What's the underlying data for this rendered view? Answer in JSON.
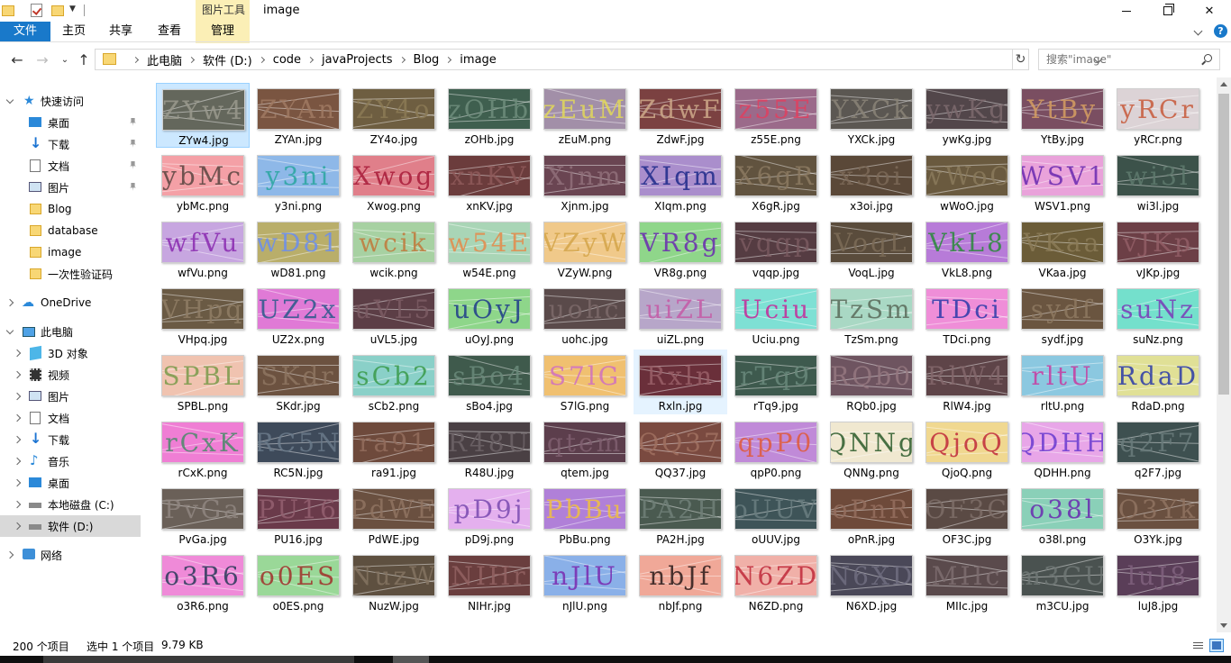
{
  "window": {
    "title": "image",
    "contextual_tab_group": "图片工具",
    "controls": {
      "minimize": "minimize",
      "maximize": "restore",
      "close": "✕"
    }
  },
  "ribbon": {
    "tabs": [
      "文件",
      "主页",
      "共享",
      "查看",
      "管理"
    ],
    "help": "?"
  },
  "address": {
    "breadcrumbs": [
      "此电脑",
      "软件 (D:)",
      "code",
      "javaProjects",
      "Blog",
      "image"
    ],
    "search_placeholder": "搜索\"image\""
  },
  "navigation": {
    "quick_access": "快速访问",
    "quick_items": [
      "桌面",
      "下载",
      "文档",
      "图片",
      "Blog",
      "database",
      "image",
      "一次性验证码"
    ],
    "onedrive": "OneDrive",
    "this_pc": "此电脑",
    "pc_items": [
      "3D 对象",
      "视频",
      "图片",
      "文档",
      "下载",
      "音乐",
      "桌面",
      "本地磁盘 (C:)",
      "软件 (D:)"
    ],
    "network": "网络"
  },
  "files": [
    {
      "name": "ZYw4.jpg",
      "text": "ZYw4",
      "bg": "#64675c",
      "fg": "#9b9a8e"
    },
    {
      "name": "ZYAn.jpg",
      "text": "ZYAn",
      "bg": "#7a5541",
      "fg": "#a07a63"
    },
    {
      "name": "ZY4o.jpg",
      "text": "ZY4o",
      "bg": "#6e5e41",
      "fg": "#8c7b56"
    },
    {
      "name": "zOHb.jpg",
      "text": "zOHb",
      "bg": "#3f5f4f",
      "fg": "#6e8d7c"
    },
    {
      "name": "zEuM.png",
      "text": "zEuM",
      "bg": "#a28fa8",
      "fg": "#e2d85a"
    },
    {
      "name": "ZdwF.jpg",
      "text": "ZdwF",
      "bg": "#7b4141",
      "fg": "#cfaa8a"
    },
    {
      "name": "z55E.png",
      "text": "z55E",
      "bg": "#9b6a8a",
      "fg": "#e04060"
    },
    {
      "name": "YXCk.jpg",
      "text": "YXCk",
      "bg": "#5b5752",
      "fg": "#8a8478"
    },
    {
      "name": "ywKg.jpg",
      "text": "ywKg",
      "bg": "#52464a",
      "fg": "#7d6a6e"
    },
    {
      "name": "YtBy.jpg",
      "text": "YtBy",
      "bg": "#7a4e61",
      "fg": "#d69f62"
    },
    {
      "name": "yRCr.png",
      "text": "yRCr",
      "bg": "#dcd3d6",
      "fg": "#c75a3a"
    },
    {
      "name": "ybMc.png",
      "text": "ybMc",
      "bg": "#f4a0a6",
      "fg": "#5a4540"
    },
    {
      "name": "y3ni.png",
      "text": "y3ni",
      "bg": "#8eb8e8",
      "fg": "#2aa6a0"
    },
    {
      "name": "Xwog.png",
      "text": "Xwog",
      "bg": "#e07f8a",
      "fg": "#a81c3a"
    },
    {
      "name": "xnKV.jpg",
      "text": "xnKV",
      "bg": "#6b3c3c",
      "fg": "#8f5a5a"
    },
    {
      "name": "Xjnm.jpg",
      "text": "Xjnm",
      "bg": "#6a4552",
      "fg": "#91707a"
    },
    {
      "name": "XIqm.png",
      "text": "XIqm",
      "bg": "#aa8ecc",
      "fg": "#1e2a8a"
    },
    {
      "name": "X6gR.jpg",
      "text": "X6gR",
      "bg": "#61533f",
      "fg": "#8c7a62"
    },
    {
      "name": "x3oi.jpg",
      "text": "x3oi",
      "bg": "#5a4838",
      "fg": "#7d6a58"
    },
    {
      "name": "wWoO.jpg",
      "text": "wWoO",
      "bg": "#6a5a3f",
      "fg": "#8a7a5c"
    },
    {
      "name": "WSV1.png",
      "text": "WSV1",
      "bg": "#e9a2da",
      "fg": "#6a2ab0"
    },
    {
      "name": "wi3l.jpg",
      "text": "wi3l",
      "bg": "#3c524a",
      "fg": "#5f7a6e"
    },
    {
      "name": "wfVu.png",
      "text": "wfVu",
      "bg": "#c7a6e0",
      "fg": "#8a2ab0"
    },
    {
      "name": "wD81.png",
      "text": "wD81",
      "bg": "#b9ae6a",
      "fg": "#6a8ef0"
    },
    {
      "name": "wcik.png",
      "text": "wcik",
      "bg": "#a7d1a2",
      "fg": "#c2783a"
    },
    {
      "name": "w54E.png",
      "text": "w54E",
      "bg": "#a9d5b6",
      "fg": "#e58a4a"
    },
    {
      "name": "VZyW.png",
      "text": "VZyW",
      "bg": "#f0c98a",
      "fg": "#d4a54a"
    },
    {
      "name": "VR8g.png",
      "text": "VR8g",
      "bg": "#8fd68a",
      "fg": "#6a2ab0"
    },
    {
      "name": "vqqp.jpg",
      "text": "vqqp",
      "bg": "#553c42",
      "fg": "#7a5a60"
    },
    {
      "name": "VoqL.jpg",
      "text": "VoqL",
      "bg": "#5a4c3c",
      "fg": "#7d6c58"
    },
    {
      "name": "VkL8.png",
      "text": "VkL8",
      "bg": "#b77bd8",
      "fg": "#2a8a3a"
    },
    {
      "name": "VKaa.jpg",
      "text": "VKaa",
      "bg": "#6b5c38",
      "fg": "#8c7c58"
    },
    {
      "name": "vJKp.jpg",
      "text": "vJKp",
      "bg": "#6c3f46",
      "fg": "#925e66"
    },
    {
      "name": "VHpq.jpg",
      "text": "VHpq",
      "bg": "#6a5a44",
      "fg": "#907e66"
    },
    {
      "name": "UZ2x.png",
      "text": "UZ2x",
      "bg": "#e07ad6",
      "fg": "#2a5a8a"
    },
    {
      "name": "uVL5.jpg",
      "text": "uVL5",
      "bg": "#5c3e46",
      "fg": "#7c5c64"
    },
    {
      "name": "uOyJ.png",
      "text": "uOyJ",
      "bg": "#8ed68a",
      "fg": "#1e3a8a"
    },
    {
      "name": "uohc.jpg",
      "text": "uohc",
      "bg": "#5a4a4a",
      "fg": "#7d6a6a"
    },
    {
      "name": "uiZL.png",
      "text": "uiZL",
      "bg": "#b7a6c9",
      "fg": "#c65aa6"
    },
    {
      "name": "Uciu.png",
      "text": "Uciu",
      "bg": "#7ee0d4",
      "fg": "#c6289a"
    },
    {
      "name": "TzSm.png",
      "text": "TzSm",
      "bg": "#a9d8c4",
      "fg": "#5a6a5a"
    },
    {
      "name": "TDci.png",
      "text": "TDci",
      "bg": "#ef8ed8",
      "fg": "#2a3aa8"
    },
    {
      "name": "sydf.jpg",
      "text": "sydf",
      "bg": "#6a5540",
      "fg": "#8f7a62"
    },
    {
      "name": "suNz.png",
      "text": "suNz",
      "bg": "#74e0cc",
      "fg": "#7a3ab8"
    },
    {
      "name": "SPBL.png",
      "text": "SPBL",
      "bg": "#f0c3b0",
      "fg": "#7a9a4a"
    },
    {
      "name": "SKdr.jpg",
      "text": "SKdr",
      "bg": "#6c5240",
      "fg": "#8f7662"
    },
    {
      "name": "sCb2.png",
      "text": "sCb2",
      "bg": "#8ad0c8",
      "fg": "#3a9a4a"
    },
    {
      "name": "sBo4.jpg",
      "text": "sBo4",
      "bg": "#3f5a4c",
      "fg": "#6a8a7a"
    },
    {
      "name": "S7lG.png",
      "text": "S7lG",
      "bg": "#f0c070",
      "fg": "#d070c0"
    },
    {
      "name": "Rxln.jpg",
      "text": "Rxln",
      "bg": "#6a2f3a",
      "fg": "#9a6068"
    },
    {
      "name": "rTq9.jpg",
      "text": "rTq9",
      "bg": "#3e5a4e",
      "fg": "#6a8a7c"
    },
    {
      "name": "RQb0.jpg",
      "text": "RQb0",
      "bg": "#6e5460",
      "fg": "#957880"
    },
    {
      "name": "RlW4.jpg",
      "text": "RlW4",
      "bg": "#5e4448",
      "fg": "#84686c"
    },
    {
      "name": "rltU.png",
      "text": "rltU",
      "bg": "#8bc8e0",
      "fg": "#c83aa0"
    },
    {
      "name": "RdaD.png",
      "text": "RdaD",
      "bg": "#e0e096",
      "fg": "#2a3aa8"
    },
    {
      "name": "rCxK.png",
      "text": "rCxK",
      "bg": "#ef7ed4",
      "fg": "#4a8a6a"
    },
    {
      "name": "RC5N.jpg",
      "text": "RC5N",
      "bg": "#3e4a5a",
      "fg": "#6a7a8a"
    },
    {
      "name": "ra91.jpg",
      "text": "ra91",
      "bg": "#6e4a3c",
      "fg": "#946e5e"
    },
    {
      "name": "R48U.jpg",
      "text": "R48U",
      "bg": "#4a4044",
      "fg": "#6e6468"
    },
    {
      "name": "qtem.jpg",
      "text": "qtem",
      "bg": "#5c3e4c",
      "fg": "#806070"
    },
    {
      "name": "QQ37.jpg",
      "text": "QQ37",
      "bg": "#7a4a40",
      "fg": "#a07060"
    },
    {
      "name": "qpP0.png",
      "text": "qpP0",
      "bg": "#c08ad8",
      "fg": "#e05a3a"
    },
    {
      "name": "QNNg.png",
      "text": "QNNg",
      "bg": "#f0e8d0",
      "fg": "#2a5a2a"
    },
    {
      "name": "QjoQ.png",
      "text": "QjoQ",
      "bg": "#f0d890",
      "fg": "#c02a3a"
    },
    {
      "name": "QDHH.png",
      "text": "QDHH",
      "bg": "#e8a6e8",
      "fg": "#6a3ad0"
    },
    {
      "name": "q2F7.jpg",
      "text": "q2F7",
      "bg": "#3e5050",
      "fg": "#6a7c7c"
    },
    {
      "name": "PvGa.jpg",
      "text": "PvGa",
      "bg": "#6a6058",
      "fg": "#908680"
    },
    {
      "name": "PU16.jpg",
      "text": "PU16",
      "bg": "#6a3a4a",
      "fg": "#946070"
    },
    {
      "name": "PdWE.jpg",
      "text": "PdWE",
      "bg": "#6a5040",
      "fg": "#907462"
    },
    {
      "name": "pD9j.png",
      "text": "pD9j",
      "bg": "#e4b0ee",
      "fg": "#7a4ab0"
    },
    {
      "name": "PbBu.png",
      "text": "PbBu",
      "bg": "#b080d8",
      "fg": "#f0c040"
    },
    {
      "name": "PA2H.jpg",
      "text": "PA2H",
      "bg": "#4a5a50",
      "fg": "#708078"
    },
    {
      "name": "oUUV.jpg",
      "text": "oUUV",
      "bg": "#3e5458",
      "fg": "#6a7e80"
    },
    {
      "name": "oPnR.jpg",
      "text": "oPnR",
      "bg": "#6e4a3a",
      "fg": "#946e5e"
    },
    {
      "name": "OF3C.jpg",
      "text": "OF3C",
      "bg": "#5a4a44",
      "fg": "#7e6e68"
    },
    {
      "name": "o38l.png",
      "text": "o38l",
      "bg": "#8ad0b8",
      "fg": "#6a2ab0"
    },
    {
      "name": "O3Yk.jpg",
      "text": "O3Yk",
      "bg": "#6a5040",
      "fg": "#907462"
    },
    {
      "name": "o3R6.png",
      "text": "o3R6",
      "bg": "#ef8ad8",
      "fg": "#2a3a5a"
    },
    {
      "name": "o0ES.png",
      "text": "o0ES",
      "bg": "#9ad898",
      "fg": "#a0302a"
    },
    {
      "name": "NuzW.jpg",
      "text": "NuzW",
      "bg": "#5e5040",
      "fg": "#847462"
    },
    {
      "name": "NIHr.jpg",
      "text": "NIHr",
      "bg": "#6a3e3e",
      "fg": "#926262"
    },
    {
      "name": "nJlU.png",
      "text": "nJlU",
      "bg": "#8ab0e8",
      "fg": "#7a2ab0"
    },
    {
      "name": "nbJf.png",
      "text": "nbJf",
      "bg": "#f0a898",
      "fg": "#2a1a1a"
    },
    {
      "name": "N6ZD.png",
      "text": "N6ZD",
      "bg": "#f0b0a8",
      "fg": "#c02a3a"
    },
    {
      "name": "N6XD.jpg",
      "text": "N6XD",
      "bg": "#4a4858",
      "fg": "#706e80"
    },
    {
      "name": "MIIc.jpg",
      "text": "MIIc",
      "bg": "#5a4a4c",
      "fg": "#7e6e70"
    },
    {
      "name": "m3CU.jpg",
      "text": "m3CU",
      "bg": "#4a5250",
      "fg": "#707876"
    },
    {
      "name": "luJ8.jpg",
      "text": "luJ8",
      "bg": "#5a3e58",
      "fg": "#80627e"
    }
  ],
  "status": {
    "item_count": "200 个项目",
    "selection": "选中 1 个项目",
    "size": "9.79 KB"
  }
}
